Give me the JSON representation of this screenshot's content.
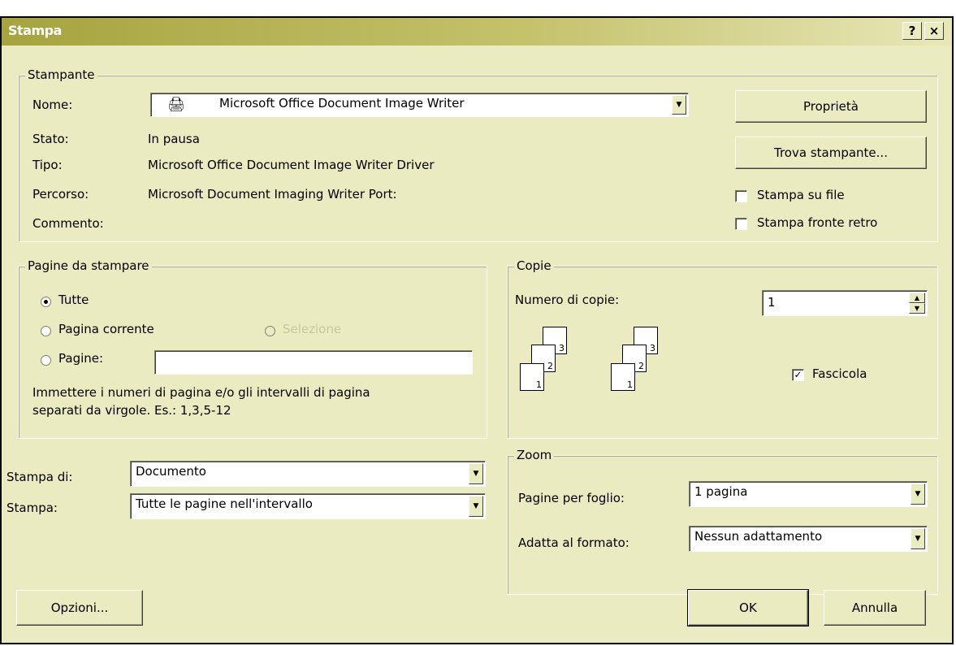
{
  "title": "Stampa",
  "titlebar": {
    "help": "?",
    "close": "×"
  },
  "printer": {
    "group_title": "Stampante",
    "name_label": "Nome:",
    "name_value": "Microsoft Office Document Image Writer",
    "status_label": "Stato:",
    "status_value": "In pausa",
    "type_label": "Tipo:",
    "type_value": "Microsoft Office Document Image Writer Driver",
    "path_label": "Percorso:",
    "path_value": "Microsoft Document Imaging Writer Port:",
    "comment_label": "Commento:",
    "properties_button": "Proprietà",
    "find_button": "Trova stampante...",
    "print_to_file": {
      "label": "Stampa su file",
      "checked": false
    },
    "duplex": {
      "label": "Stampa fronte retro",
      "checked": false
    }
  },
  "page_range": {
    "group_title": "Pagine da stampare",
    "all": "Tutte",
    "current": "Pagina corrente",
    "selection": "Selezione",
    "pages": "Pagine:",
    "pages_value": "",
    "hint_line1": "Immettere i numeri di pagina e/o gli intervalli di pagina",
    "hint_line2": "separati da virgole. Es.: 1,3,5-12",
    "selected": "all"
  },
  "copies": {
    "group_title": "Copie",
    "count_label": "Numero di copie:",
    "count_value": "1",
    "collate": {
      "label": "Fascicola",
      "checked": true
    },
    "page_numbers": [
      "3",
      "2",
      "1"
    ]
  },
  "print_what": {
    "label": "Stampa di:",
    "value": "Documento"
  },
  "print_pages": {
    "label": "Stampa:",
    "value": "Tutte le pagine nell'intervallo"
  },
  "zoom": {
    "group_title": "Zoom",
    "pages_per_sheet_label": "Pagine per foglio:",
    "pages_per_sheet_value": "1 pagina",
    "scale_label": "Adatta al formato:",
    "scale_value": "Nessun adattamento"
  },
  "buttons": {
    "options": "Opzioni...",
    "ok": "OK",
    "cancel": "Annulla"
  }
}
